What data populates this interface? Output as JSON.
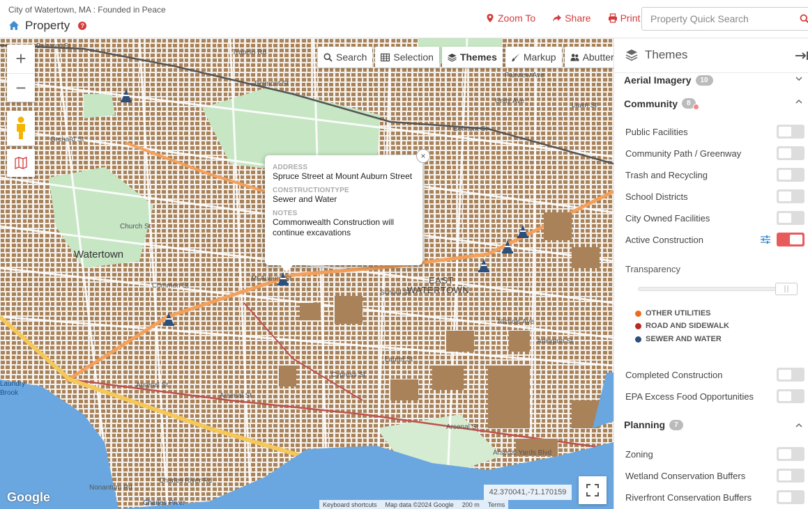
{
  "header": {
    "city": "City of Watertown, MA : Founded in Peace",
    "app_title": "Property",
    "actions": {
      "zoom_to": "Zoom To",
      "share": "Share",
      "print": "Print"
    },
    "search_placeholder": "Property Quick Search"
  },
  "map": {
    "tools": {
      "search": "Search",
      "selection": "Selection",
      "themes": "Themes",
      "markup": "Markup",
      "abutters": "Abutters"
    },
    "zoom_in": "+",
    "zoom_out": "−",
    "popup": {
      "address_key": "ADDRESS",
      "address_val": "Spruce Street at Mount Auburn Street",
      "constructiontype_key": "CONSTRUCTIONTYPE",
      "constructiontype_val": "Sewer and Water",
      "notes_key": "NOTES",
      "notes_val": "Commonwealth Construction will continue excavations"
    },
    "labels": {
      "watertown": "Watertown",
      "east": "EAST",
      "east_watertown": "WATERTOWN",
      "belmont_st_1": "Belmont St",
      "belmont_st_2": "Belmont St",
      "belmont_st_3": "Belmont St",
      "trapelo": "Trapelo Rd",
      "orchard": "Orchard St",
      "arsenal_1": "Arsenal St",
      "arsenal_2": "Arsenal St",
      "arsenal_3": "Arsenal St",
      "mt_auburn": "Mt Auburn St",
      "common": "Common St",
      "church": "Church St",
      "charles_river_rd": "Charles River Rd",
      "charles_river": "Charles River",
      "school_st": "School St",
      "nichols": "Nichols Ave",
      "arlington": "Arlington St",
      "arsenal_yards": "Arsenal Yards Blvd",
      "laurel": "Laurel St",
      "cypress": "Cypress St",
      "pleasant": "Pleasant St",
      "brook": "Brook",
      "foundry": "Laundry",
      "nonantum": "Nonantum Rd",
      "fairview": "Fairview Ave",
      "unity": "Unity Ave",
      "lawn": "Lawn St"
    },
    "coords": "42.370041,-71.170159",
    "attribution": {
      "keyboard": "Keyboard shortcuts",
      "mapdata": "Map data ©2024 Google",
      "scale": "200 m",
      "terms": "Terms"
    },
    "google": "Google"
  },
  "sidebar": {
    "title": "Themes",
    "groups": [
      {
        "title": "Aerial Imagery",
        "count": "10"
      },
      {
        "title": "Community",
        "count": "8"
      },
      {
        "title": "Planning",
        "count": "7"
      }
    ],
    "community_layers": [
      {
        "label": "Public Facilities",
        "on": false
      },
      {
        "label": "Community Path / Greenway",
        "on": false
      },
      {
        "label": "Trash and Recycling",
        "on": false
      },
      {
        "label": "School Districts",
        "on": false
      },
      {
        "label": "City Owned Facilities",
        "on": false
      },
      {
        "label": "Active Construction",
        "on": true
      }
    ],
    "transparency_label": "Transparency",
    "transparency_value": 0.94,
    "legend": [
      {
        "label": "OTHER UTILITIES",
        "color": "#ef6c1a"
      },
      {
        "label": "ROAD AND SIDEWALK",
        "color": "#b72b20"
      },
      {
        "label": "SEWER AND WATER",
        "color": "#2c4f7c"
      }
    ],
    "more_community_layers": [
      {
        "label": "Completed Construction",
        "on": false
      },
      {
        "label": "EPA Excess Food Opportunities",
        "on": false
      }
    ],
    "planning_layers": [
      {
        "label": "Zoning",
        "on": false
      },
      {
        "label": "Wetland Conservation Buffers",
        "on": false
      },
      {
        "label": "Riverfront Conservation Buffers",
        "on": false
      }
    ]
  },
  "colors": {
    "accent": "#d33b3b",
    "building": "#a9825a",
    "park": "#c6e6c4",
    "water": "#6aa7e0",
    "road_orange": "#f5a623"
  }
}
